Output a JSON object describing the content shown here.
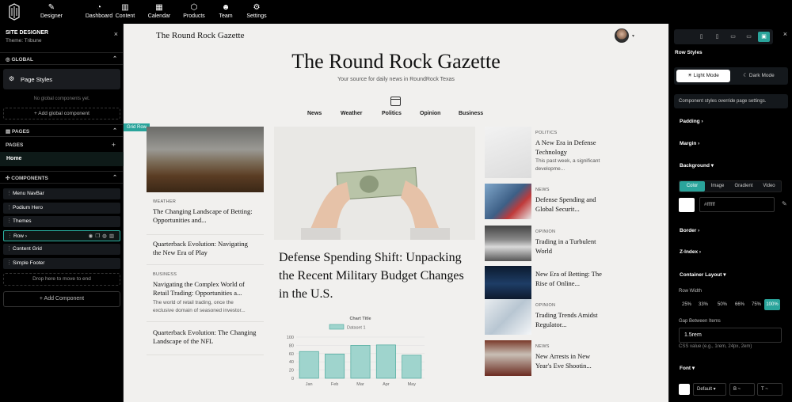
{
  "nav": [
    {
      "label": "Designer",
      "icon": "palette-icon",
      "glyph": "✎"
    },
    {
      "label": "Dashboard",
      "icon": "dashboard-icon",
      "glyph": "◔"
    },
    {
      "label": "Content",
      "icon": "bar-chart-icon",
      "glyph": "▥"
    },
    {
      "label": "Calendar",
      "icon": "calendar-icon",
      "glyph": "▦"
    },
    {
      "label": "Products",
      "icon": "box-icon",
      "glyph": "⬡"
    },
    {
      "label": "Team",
      "icon": "team-icon",
      "glyph": "☻"
    },
    {
      "label": "Settings",
      "icon": "gear-icon",
      "glyph": "⚙"
    }
  ],
  "left": {
    "title": "SITE DESIGNER",
    "theme": "Theme: Tribune",
    "global_header": "GLOBAL",
    "page_styles": "Page Styles",
    "no_global": "No global components yet.",
    "add_global": "+ Add global component",
    "pages_header": "PAGES",
    "pages_label": "PAGES",
    "home": "Home",
    "components_header": "COMPONENTS",
    "components": [
      "Menu NavBar",
      "Podium Hero",
      "Themes",
      "Row",
      "Content Grid",
      "Simple Footer"
    ],
    "drop_here": "Drop here to move to end",
    "add_component": "+ Add Component"
  },
  "site": {
    "brand_small": "The Round Rock Gazette",
    "title": "The Round Rock Gazette",
    "tagline": "Your source for daily news in RoundRock Texas",
    "categories": [
      "News",
      "Weather",
      "Politics",
      "Opinion",
      "Business"
    ],
    "grid_tag": "Grid Row",
    "col1": [
      {
        "kicker": "WEATHER",
        "headline": "The Changing Landscape of Betting: Opportunities and...",
        "excerpt": ""
      },
      {
        "kicker": "",
        "headline": "Quarterback Evolution: Navigating the New Era of Play",
        "excerpt": ""
      },
      {
        "kicker": "BUSINESS",
        "headline": "Navigating the Complex World of Retail Trading: Opportunities a...",
        "excerpt": "The world of retail trading, once the exclusive domain of seasoned investor..."
      },
      {
        "kicker": "",
        "headline": "Quarterback Evolution: The Changing Landscape of the NFL",
        "excerpt": ""
      }
    ],
    "feature_headline": "Defense Spending Shift: Unpacking the Recent Military Budget Changes in the U.S.",
    "col3": [
      {
        "kicker": "POLITICS",
        "headline": "A New Era in Defense Technology",
        "excerpt": "This past week, a significant developme..."
      },
      {
        "kicker": "NEWS",
        "headline": "Defense Spending and Global Securit...",
        "excerpt": ""
      },
      {
        "kicker": "OPINION",
        "headline": "Trading in a Turbulent World",
        "excerpt": ""
      },
      {
        "kicker": "",
        "headline": "New Era of Betting: The Rise of Online...",
        "excerpt": ""
      },
      {
        "kicker": "OPINION",
        "headline": "Trading Trends Amidst Regulator...",
        "excerpt": ""
      },
      {
        "kicker": "NEWS",
        "headline": "New Arrests in New Year's Eve Shootin...",
        "excerpt": ""
      }
    ]
  },
  "chart_data": {
    "type": "bar",
    "title": "Chart Title",
    "categories": [
      "Jan",
      "Feb",
      "Mar",
      "Apr",
      "May"
    ],
    "series": [
      {
        "name": "Dataset 1",
        "values": [
          65,
          59,
          80,
          81,
          56
        ]
      }
    ],
    "ylim": [
      0,
      100
    ],
    "yticks": [
      0,
      20,
      40,
      60,
      80,
      100
    ],
    "colors": {
      "bar": "#9fd4cd",
      "stroke": "#4aa89c"
    }
  },
  "right": {
    "row_styles": "Row Styles",
    "light_mode": "Light Mode",
    "dark_mode": "Dark Mode",
    "note": "Component styles override page settings.",
    "padding": "Padding",
    "margin": "Margin",
    "background": "Background",
    "bg_tabs": [
      "Color",
      "Image",
      "Gradient",
      "Video"
    ],
    "color_value": "#ffffff",
    "border": "Border",
    "zindex": "Z-Index",
    "container_layout": "Container Layout",
    "row_width": "Row Width",
    "widths": [
      "25%",
      "33%",
      "50%",
      "66%",
      "75%",
      "100%"
    ],
    "gap_label": "Gap Between Items",
    "gap_value": "1.5rem",
    "css_hint": "CSS value (e.g., 1rem, 24px, 2em)",
    "font": "Font",
    "font_default": "Default",
    "font_b": "B ~",
    "font_t": "T ~"
  },
  "accent": "#2aa49b"
}
